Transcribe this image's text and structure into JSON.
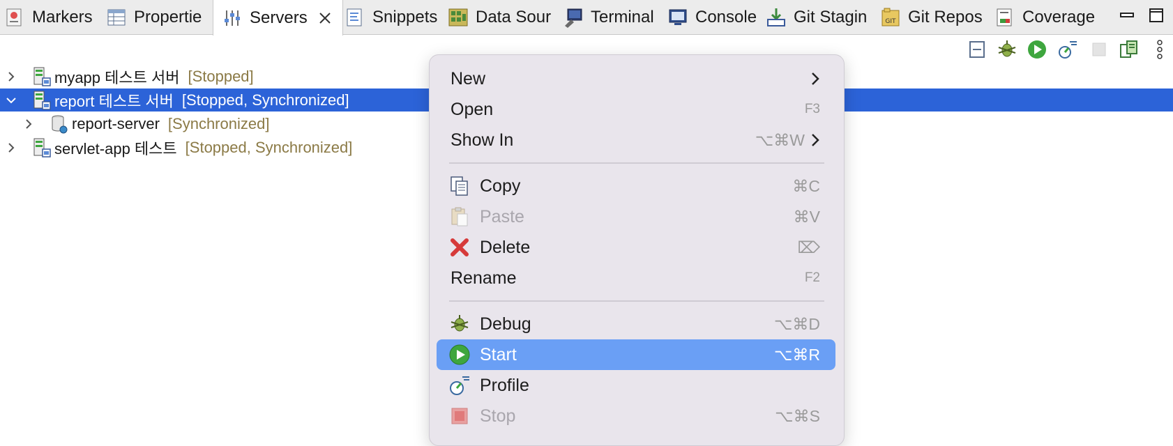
{
  "tabs": [
    {
      "label": "Markers",
      "icon": "markers-icon"
    },
    {
      "label": "Propertie",
      "icon": "properties-icon"
    },
    {
      "label": "Servers",
      "icon": "servers-icon",
      "active": true
    },
    {
      "label": "Snippets",
      "icon": "snippets-icon"
    },
    {
      "label": "Data Sour",
      "icon": "data-source-icon"
    },
    {
      "label": "Terminal",
      "icon": "terminal-icon"
    },
    {
      "label": "Console",
      "icon": "console-icon"
    },
    {
      "label": "Git Stagin",
      "icon": "git-staging-icon"
    },
    {
      "label": "Git Repos",
      "icon": "git-repos-icon"
    },
    {
      "label": "Coverage",
      "icon": "coverage-icon"
    }
  ],
  "tree": [
    {
      "name": "myapp 테스트 서버",
      "status": "[Stopped]",
      "expanded": false,
      "selected": false
    },
    {
      "name": "report 테스트 서버",
      "status": "[Stopped, Synchronized]",
      "expanded": true,
      "selected": true
    },
    {
      "name": "report-server",
      "status": "[Synchronized]",
      "expanded": false,
      "selected": false,
      "child": true
    },
    {
      "name": "servlet-app 테스트",
      "status": "[Stopped, Synchronized]",
      "expanded": false,
      "selected": false
    }
  ],
  "menu": {
    "new": {
      "label": "New"
    },
    "open": {
      "label": "Open",
      "shortcut": "F3"
    },
    "show_in": {
      "label": "Show In",
      "shortcut": "⌥⌘W"
    },
    "copy": {
      "label": "Copy",
      "shortcut": "⌘C"
    },
    "paste": {
      "label": "Paste",
      "shortcut": "⌘V"
    },
    "delete": {
      "label": "Delete",
      "shortcut": "⌦"
    },
    "rename": {
      "label": "Rename",
      "shortcut": "F2"
    },
    "debug": {
      "label": "Debug",
      "shortcut": "⌥⌘D"
    },
    "start": {
      "label": "Start",
      "shortcut": "⌥⌘R"
    },
    "profile": {
      "label": "Profile"
    },
    "stop": {
      "label": "Stop",
      "shortcut": "⌥⌘S"
    }
  },
  "colors": {
    "selection": "#2c63d8",
    "menu_highlight": "#6a9ff5",
    "status_text": "#8b7a46",
    "menu_bg": "#e9e5ec"
  }
}
